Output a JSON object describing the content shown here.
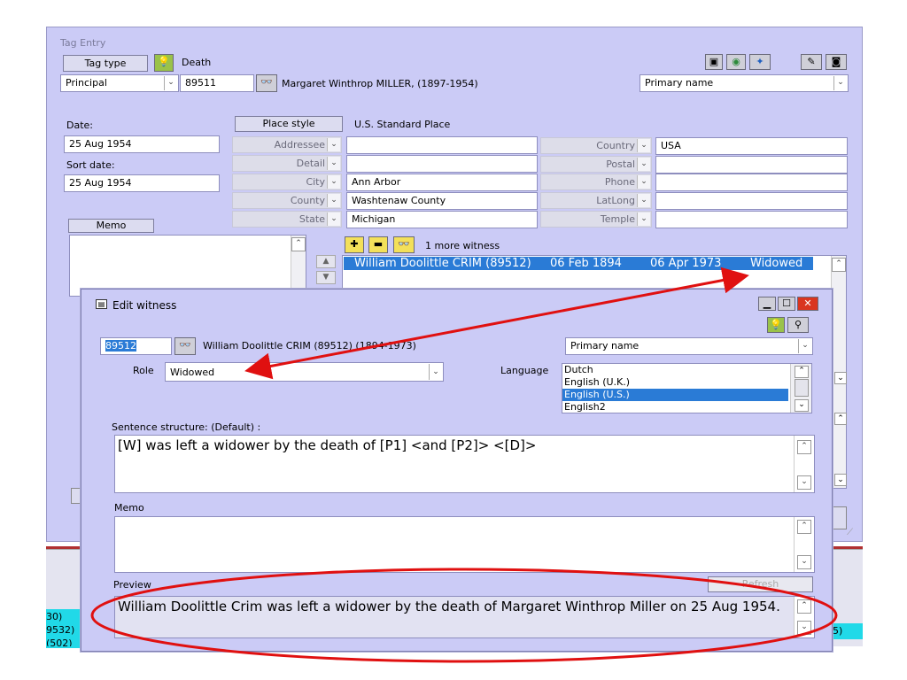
{
  "tag_entry": {
    "title": "Tag Entry",
    "tag_type_button": "Tag type",
    "tag_type_value": "Death",
    "role_value": "Principal",
    "person_id": "89511",
    "person_name": "Margaret Winthrop MILLER, (1897-1954)",
    "name_type": "Primary name",
    "date_label": "Date:",
    "date_value": "25 Aug 1954",
    "sort_date_label": "Sort date:",
    "sort_date_value": "25 Aug 1954",
    "memo_button": "Memo",
    "place_style_button": "Place style",
    "place_style_value": "U.S. Standard Place",
    "place_fields": [
      {
        "label": "Addressee",
        "value": ""
      },
      {
        "label": "Detail",
        "value": ""
      },
      {
        "label": "City",
        "value": "Ann Arbor"
      },
      {
        "label": "County",
        "value": "Washtenaw County"
      },
      {
        "label": "State",
        "value": "Michigan"
      }
    ],
    "place_fields_right": [
      {
        "label": "Country",
        "value": "USA"
      },
      {
        "label": "Postal",
        "value": ""
      },
      {
        "label": "Phone",
        "value": ""
      },
      {
        "label": "LatLong",
        "value": ""
      },
      {
        "label": "Temple",
        "value": ""
      }
    ],
    "witness_count": "1 more witness",
    "witness_row": {
      "name": "William Doolittle CRIM (89512)",
      "birth": "06 Feb 1894",
      "death": "06 Apr 1973",
      "role": "Widowed"
    }
  },
  "edit_witness": {
    "title": "Edit witness",
    "witness_id": "89512",
    "witness_name": "William Doolittle CRIM (89512) (1894-1973)",
    "name_type": "Primary name",
    "role_label": "Role",
    "role_value": "Widowed",
    "language_label": "Language",
    "languages": [
      "Dutch",
      "English (U.K.)",
      "English (U.S.)",
      "English2"
    ],
    "sentence_label": "Sentence structure: (Default) :",
    "sentence_value": "[W] was left a widower by the death of [P1] <and [P2]> <[D]>",
    "memo_label": "Memo",
    "preview_label": "Preview",
    "refresh_button": "Refresh",
    "preview_text": "William Doolittle Crim was left a widower by the death of Margaret Winthrop Miller on 25 Aug 1954."
  },
  "background_fragments": {
    "left": [
      "30)",
      "9532)",
      "(502)"
    ],
    "right": "5)"
  },
  "colors": {
    "window_bg": "#cbcbf6",
    "selection": "#2a7bd6",
    "annotation": "#e01010"
  }
}
